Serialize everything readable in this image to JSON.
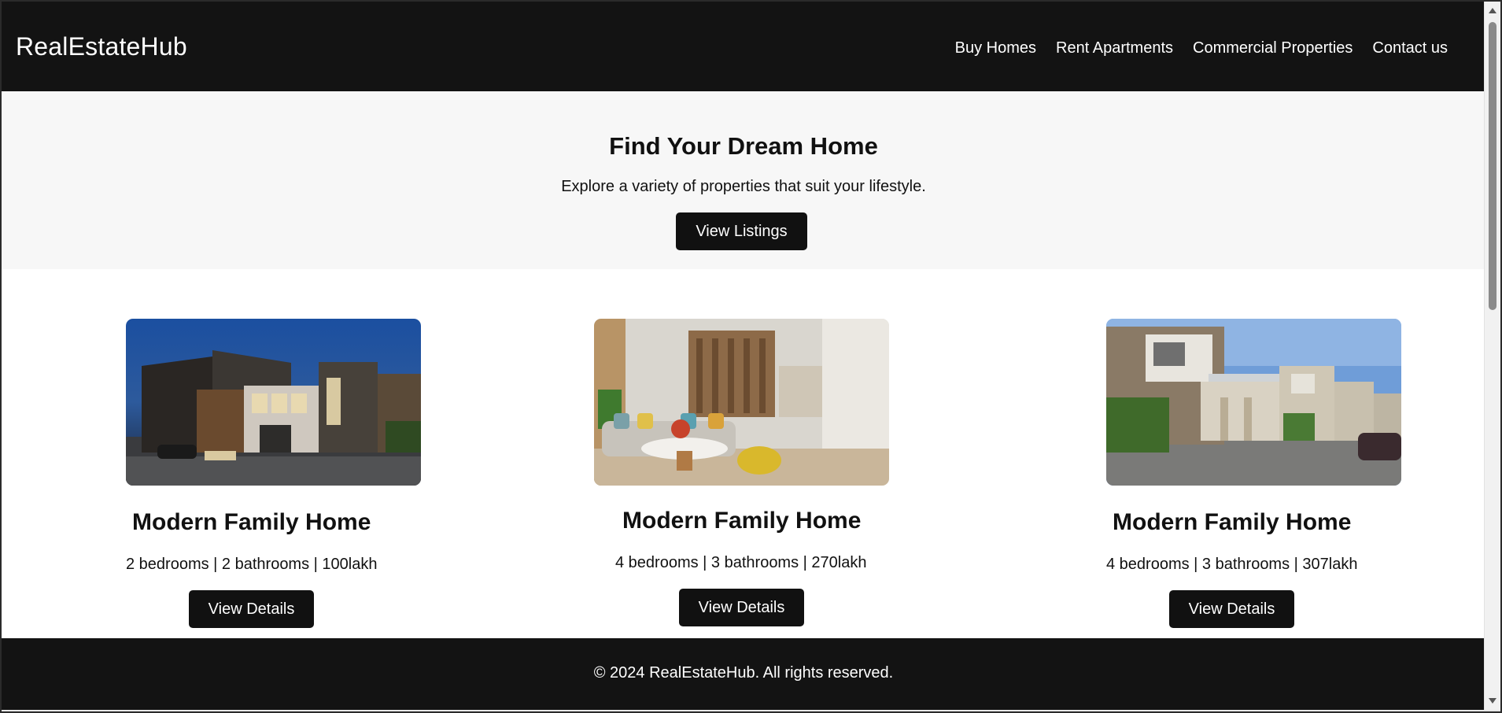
{
  "header": {
    "brand": "RealEstateHub",
    "nav": [
      "Buy Homes",
      "Rent Apartments",
      "Commercial Properties",
      "Contact us"
    ]
  },
  "hero": {
    "title": "Find Your Dream Home",
    "subtitle": "Explore a variety of properties that suit your lifestyle.",
    "cta": "View Listings"
  },
  "listings": [
    {
      "title": "Modern Family Home",
      "meta": "2 bedrooms | 2 bathrooms | 100lakh",
      "button": "View Details",
      "image": "modern-villa-exterior-night-photo"
    },
    {
      "title": "Modern Family Home",
      "meta": "4 bedrooms | 3 bathrooms | 270lakh",
      "button": "View Details",
      "image": "living-room-interior-photo"
    },
    {
      "title": "Modern Family Home",
      "meta": "4 bedrooms | 3 bathrooms | 307lakh",
      "button": "View Details",
      "image": "row-houses-exterior-photo"
    }
  ],
  "footer": {
    "text": "© 2024 RealEstateHub. All rights reserved."
  },
  "colors": {
    "dark": "#131313",
    "hero_bg": "#f7f7f7",
    "button": "#111111"
  }
}
